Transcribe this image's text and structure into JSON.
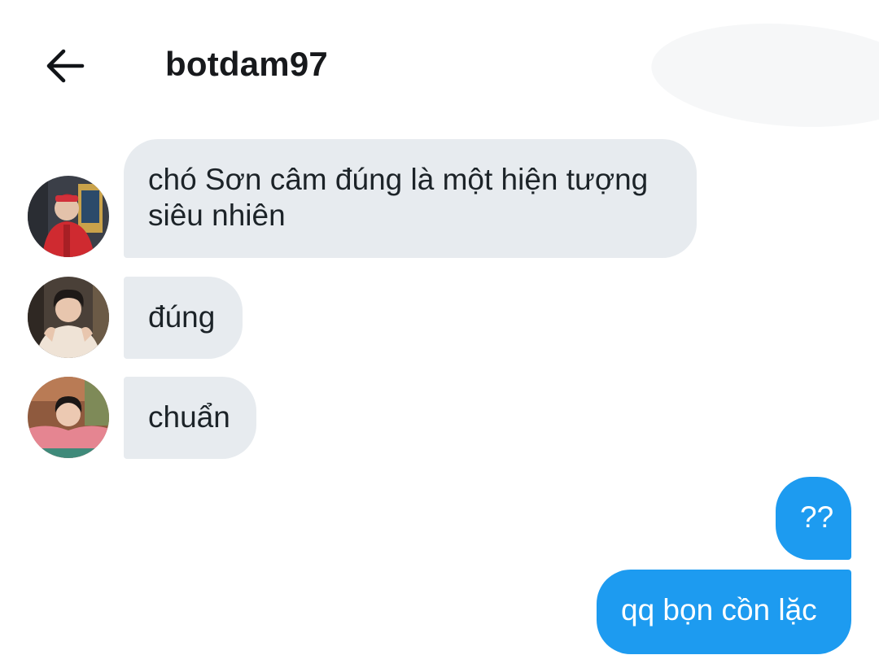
{
  "header": {
    "back_icon": "arrow-left-icon",
    "title": "botdam97"
  },
  "colors": {
    "incoming_bubble": "#e7ebef",
    "outgoing_bubble": "#1d9bf0",
    "text": "#1c2328"
  },
  "messages": [
    {
      "direction": "incoming",
      "text": "chó Sơn câm đúng là một hiện tượng siêu nhiên",
      "avatar": "avatar-red-jacket"
    },
    {
      "direction": "incoming",
      "text": "đúng",
      "avatar": "avatar-curly-hair"
    },
    {
      "direction": "incoming",
      "text": "chuẩn",
      "avatar": "avatar-pink-sweater"
    },
    {
      "direction": "outgoing",
      "text": "??"
    },
    {
      "direction": "outgoing",
      "text": "qq bọn cồn lặc"
    }
  ]
}
